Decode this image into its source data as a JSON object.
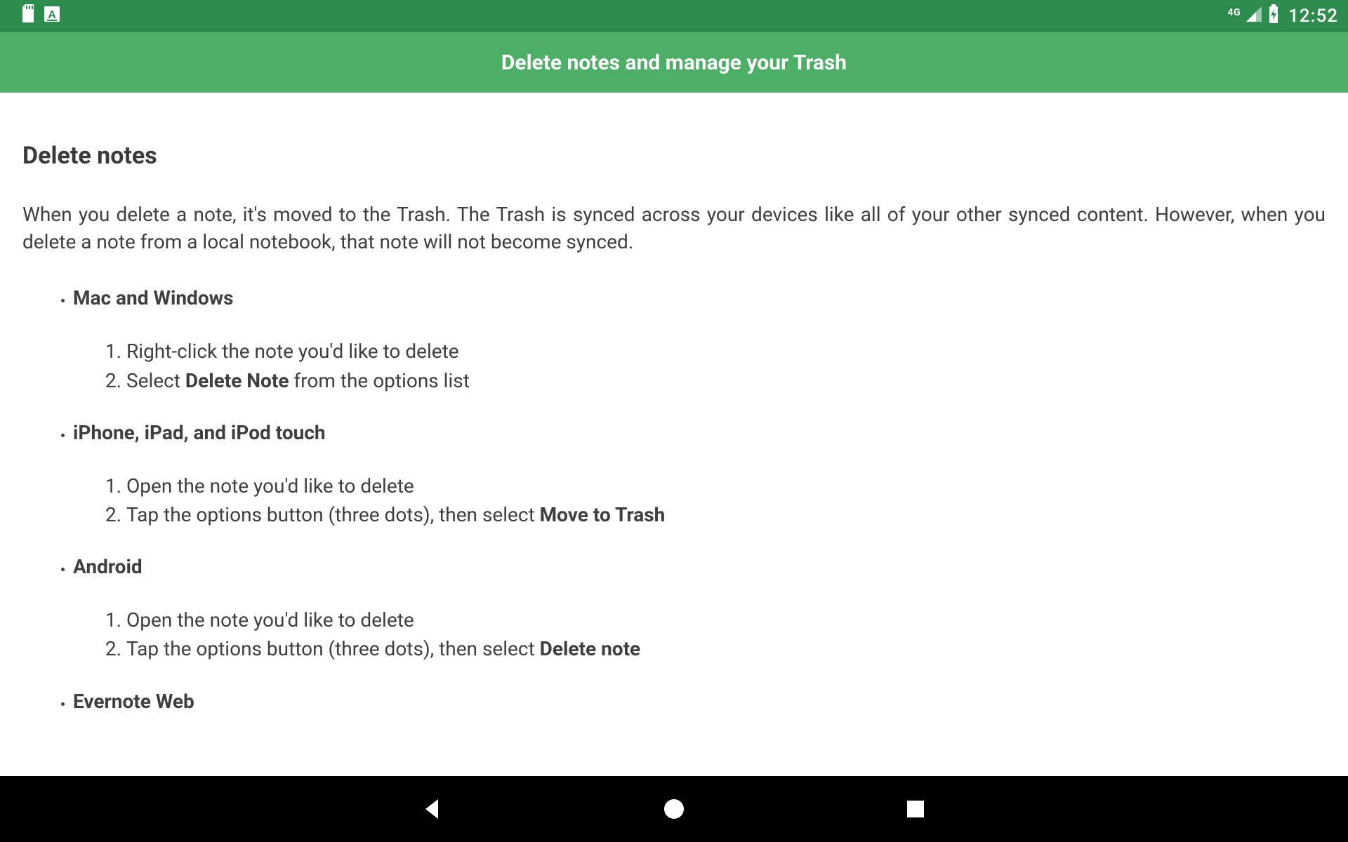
{
  "status_bar": {
    "network_label": "4G",
    "time": "12:52"
  },
  "app_bar": {
    "title": "Delete notes and manage your Trash"
  },
  "page": {
    "heading": "Delete notes",
    "intro": "When you delete a note, it's moved to the Trash. The Trash is synced across your devices like all of your other synced content. However, when you delete a note from a local notebook, that note will not become synced.",
    "platforms": [
      {
        "name": "Mac and Windows",
        "steps": [
          {
            "pre": "Right-click the note you'd like to delete",
            "bold": "",
            "post": ""
          },
          {
            "pre": "Select ",
            "bold": "Delete Note",
            "post": " from the options list"
          }
        ]
      },
      {
        "name": "iPhone, iPad, and iPod touch",
        "steps": [
          {
            "pre": "Open the note you'd like to delete",
            "bold": "",
            "post": ""
          },
          {
            "pre": "Tap the options button (three dots), then select ",
            "bold": "Move to Trash",
            "post": ""
          }
        ]
      },
      {
        "name": "Android",
        "steps": [
          {
            "pre": "Open the note you'd like to delete",
            "bold": "",
            "post": ""
          },
          {
            "pre": "Tap the options button (three dots), then select ",
            "bold": "Delete note",
            "post": ""
          }
        ]
      },
      {
        "name": "Evernote Web",
        "steps": []
      }
    ]
  }
}
